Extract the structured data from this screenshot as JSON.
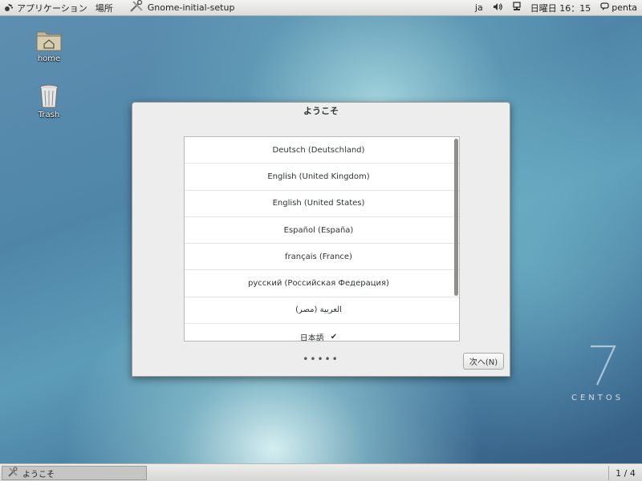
{
  "top_panel": {
    "applications_label": "アプリケーション",
    "places_label": "場所",
    "window_title": "Gnome-initial-setup",
    "keyboard_layout": "ja",
    "clock": "日曜日 16：15",
    "user_name": "penta"
  },
  "desktop": {
    "icons": [
      {
        "label": "home",
        "icon": "folder-home-icon"
      },
      {
        "label": "Trash",
        "icon": "trash-icon"
      }
    ]
  },
  "dialog": {
    "title": "ようこそ",
    "languages": [
      {
        "label": "Deutsch (Deutschland)",
        "selected": false
      },
      {
        "label": "English (United Kingdom)",
        "selected": false
      },
      {
        "label": "English (United States)",
        "selected": false
      },
      {
        "label": "Español (España)",
        "selected": false
      },
      {
        "label": "français (France)",
        "selected": false
      },
      {
        "label": "русский (Российская Федерация)",
        "selected": false
      },
      {
        "label": "العربية (مصر)",
        "selected": false
      },
      {
        "label": "日本語",
        "selected": true
      }
    ],
    "check_mark": "✔",
    "page_dots": "•••••",
    "next_button": "次へ(N)"
  },
  "branding": {
    "numeral": "7",
    "word": "CENTOS"
  },
  "bottom_panel": {
    "task_label": "ようこそ",
    "workspace": "1 / 4"
  }
}
